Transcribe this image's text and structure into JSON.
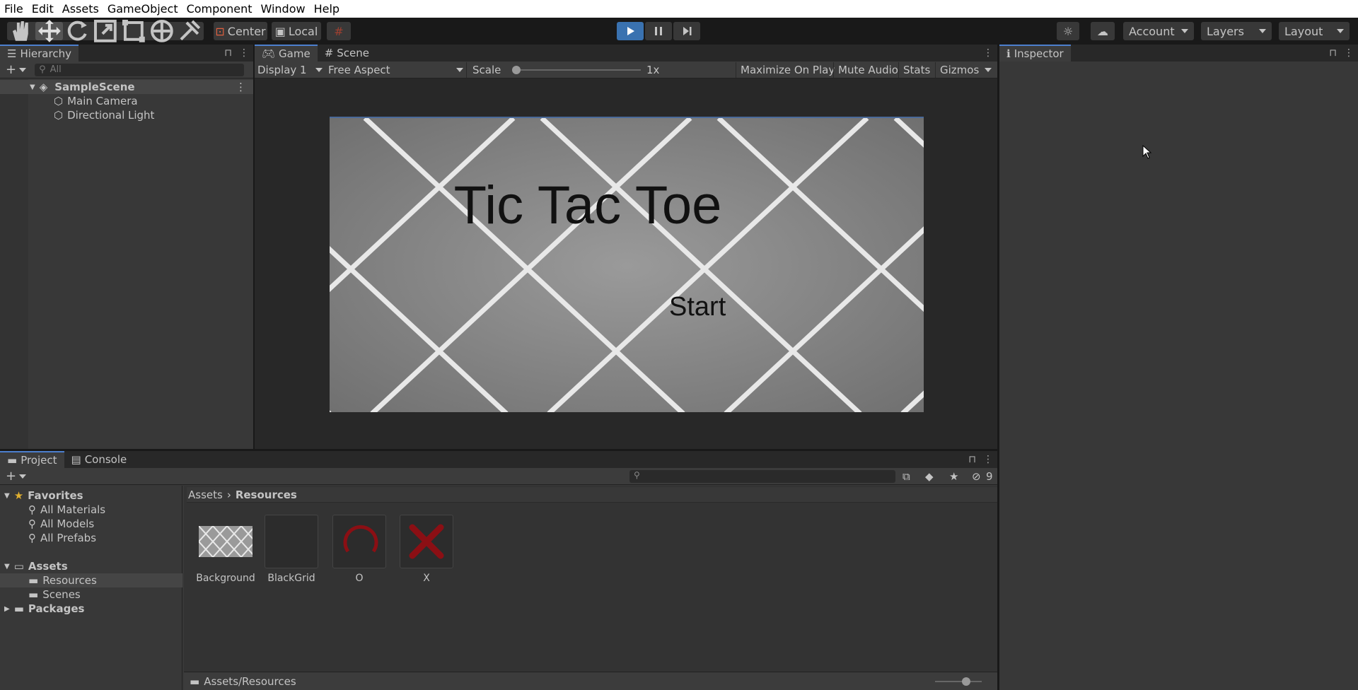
{
  "menu": [
    "File",
    "Edit",
    "Assets",
    "GameObject",
    "Component",
    "Window",
    "Help"
  ],
  "toolbar": {
    "pivot": "Center",
    "space": "Local",
    "account": "Account",
    "layers": "Layers",
    "layout": "Layout"
  },
  "hierarchy": {
    "tab": "Hierarchy",
    "search_placeholder": "All",
    "scene": "SampleScene",
    "objects": [
      "Main Camera",
      "Directional Light"
    ]
  },
  "game": {
    "tabs": [
      "Game",
      "Scene"
    ],
    "display": "Display 1",
    "aspect": "Free Aspect",
    "scale_label": "Scale",
    "scale_value": "1x",
    "scale_level": 0.0,
    "buttons": [
      "Maximize On Play",
      "Mute Audio",
      "Stats",
      "Gizmos"
    ],
    "title": "Tic Tac Toe",
    "start": "Start"
  },
  "inspector": {
    "tab": "Inspector"
  },
  "project": {
    "tabs": [
      "Project",
      "Console"
    ],
    "hidden_count": "9",
    "favorites": "Favorites",
    "favorite_items": [
      "All Materials",
      "All Models",
      "All Prefabs"
    ],
    "assets": "Assets",
    "asset_folders": [
      "Resources",
      "Scenes"
    ],
    "packages": "Packages",
    "breadcrumb": [
      "Assets",
      "Resources"
    ],
    "items": [
      "Background",
      "BlackGrid",
      "O",
      "X"
    ],
    "footer_path": "Assets/Resources"
  },
  "colors": {
    "accent": "#4c7fce",
    "play_active": "#3a72b0",
    "asset_red": "#8b0f14"
  }
}
